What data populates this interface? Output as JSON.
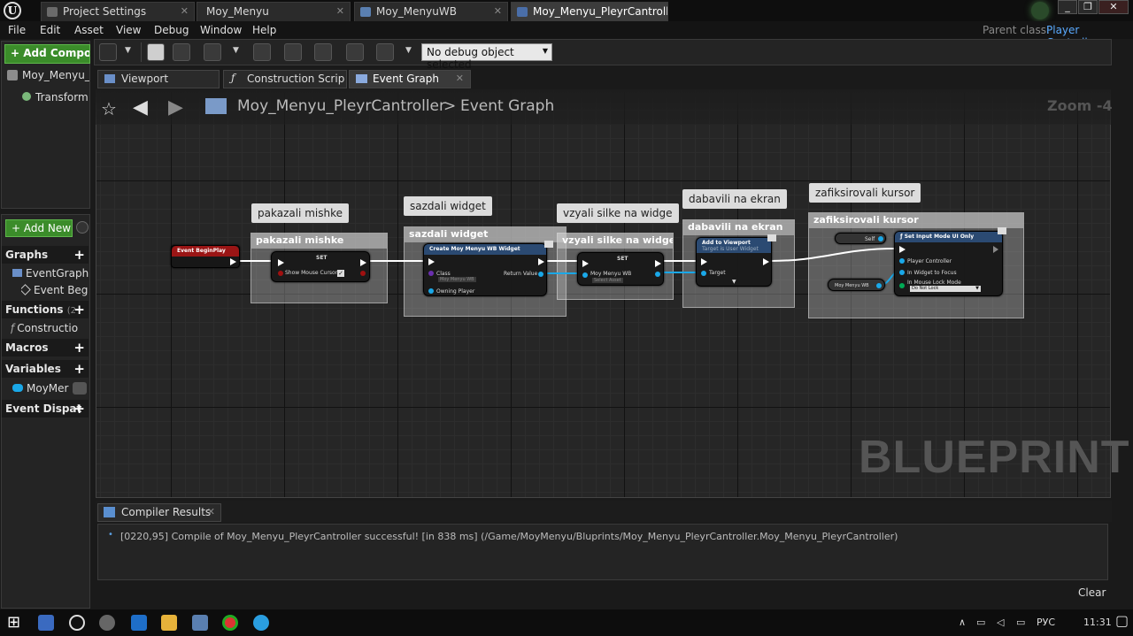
{
  "window": {
    "tabs": [
      {
        "label": "Project Settings",
        "icon": "settings-icon",
        "active": false
      },
      {
        "label": "Moy_Menyu",
        "icon": "",
        "active": false
      },
      {
        "label": "Moy_MenyuWB",
        "icon": "widget-blueprint-icon",
        "active": false
      },
      {
        "label": "Moy_Menyu_PleyrCantroll",
        "icon": "blueprint-icon",
        "active": true
      }
    ],
    "controls": {
      "minimize": "_",
      "maximize": "❐",
      "close": "✕"
    }
  },
  "menubar": {
    "items": [
      "File",
      "Edit",
      "Asset",
      "View",
      "Debug",
      "Window",
      "Help"
    ],
    "parent_class_label": "Parent class:",
    "parent_class_value": "Player Controller"
  },
  "components": {
    "add_button": "+ Add Compon",
    "root_item": "Moy_Menyu_P",
    "child_item": "TransformC"
  },
  "my_blueprint": {
    "add_new_button": "+ Add New",
    "sections": {
      "graphs": "Graphs",
      "event_graph": "EventGraph",
      "event_begin": "Event Beg",
      "functions": "Functions",
      "functions_count": "(2",
      "construction": "Constructio",
      "macros": "Macros",
      "variables": "Variables",
      "variable_item": "MoyMer",
      "event_dispatchers": "Event Dispat"
    }
  },
  "toolbar": {
    "debug_selector": "No debug object selected"
  },
  "editor_tabs": [
    {
      "label": "Viewport",
      "icon": "viewport-icon",
      "active": false
    },
    {
      "label": "Construction Scrip",
      "icon": "function-icon",
      "active": false
    },
    {
      "label": "Event Graph",
      "icon": "graph-icon",
      "active": true
    }
  ],
  "graph": {
    "breadcrumb_root": "Moy_Menyu_PleyrCantroller",
    "breadcrumb_sep": ">",
    "breadcrumb_leaf": "Event Graph",
    "zoom": "Zoom -4",
    "watermark": "BLUEPRINT",
    "comments": [
      {
        "bubble": "pakazali mishke",
        "title": "pakazali mishke"
      },
      {
        "bubble": "sazdali widget",
        "title": "sazdali widget"
      },
      {
        "bubble": "vzyali silke na widge",
        "title": "vzyali silke na widge"
      },
      {
        "bubble": "dabavili na ekran",
        "title": "dabavili na ekran"
      },
      {
        "bubble": "zafiksirovali kursor",
        "title": "zafiksirovali kursor"
      }
    ],
    "nodes": {
      "begin_play": "Event BeginPlay",
      "set1_title": "SET",
      "set1_pin": "Show Mouse Cursor",
      "create_title": "Create Moy Menyu WB Widget",
      "create_class": "Class",
      "create_class_value": "Moy Menyu WB",
      "create_return": "Return Value",
      "create_owner": "Owning Player",
      "set2_title": "SET",
      "set2_pin": "Moy Menyu WB",
      "set2_value": "Select Asset",
      "add_viewport_title": "Add to Viewport",
      "add_viewport_sub": "Target is User Widget",
      "add_viewport_target": "Target",
      "self_label": "Self",
      "var_label": "Moy Menyu WB",
      "input_mode_title": "Set Input Mode UI Only",
      "input_pc": "Player Controller",
      "input_widget": "In Widget to Focus",
      "input_lock": "In Mouse Lock Mode",
      "input_lock_value": "Do Not Lock"
    }
  },
  "compiler": {
    "tab": "Compiler Results",
    "message": "[0220,95] Compile of Moy_Menyu_PleyrCantroller successful! [in 838 ms] (/Game/MoyMenyu/Bluprints/Moy_Menyu_PleyrCantroller.Moy_Menyu_PleyrCantroller)",
    "clear": "Clear"
  },
  "taskbar": {
    "language": "РУС",
    "time": "11:31"
  }
}
